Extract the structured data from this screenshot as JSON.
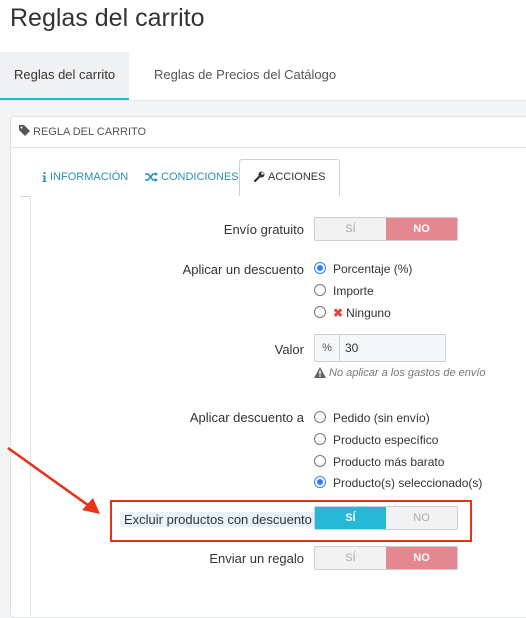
{
  "header": {
    "title": "Reglas del carrito"
  },
  "subtabs": [
    {
      "label": "Reglas del carrito"
    },
    {
      "label": "Reglas de Precios del Catálogo"
    }
  ],
  "panel": {
    "heading": "REGLA DEL CARRITO"
  },
  "tabs": [
    {
      "label": "INFORMACIÓN",
      "icon": "info-icon"
    },
    {
      "label": "CONDICIONES",
      "icon": "shuffle-icon"
    },
    {
      "label": "ACCIONES",
      "icon": "wrench-icon"
    }
  ],
  "form": {
    "free_shipping": {
      "label": "Envío gratuito",
      "yes": "SÍ",
      "no": "NO",
      "selected": "NO"
    },
    "discount": {
      "label": "Aplicar un descuento",
      "options": [
        "Porcentaje (%)",
        "Importe",
        "Ninguno"
      ],
      "selected": "Porcentaje (%)"
    },
    "value": {
      "label": "Valor",
      "addon": "%",
      "value": "30",
      "help": "No aplicar a los gastos de envío"
    },
    "apply_to": {
      "label": "Aplicar descuento a",
      "options": [
        "Pedido (sin envío)",
        "Producto específico",
        "Producto más barato",
        "Producto(s) seleccionado(s)"
      ],
      "selected": "Producto(s) seleccionado(s)"
    },
    "exclude_discounted": {
      "label": "Excluir productos con descuento",
      "yes": "SÍ",
      "no": "NO",
      "selected": "SÍ"
    },
    "gift": {
      "label": "Enviar un regalo",
      "yes": "SÍ",
      "no": "NO",
      "selected": "NO"
    }
  },
  "colors": {
    "accent": "#25b9d7",
    "no_active": "#e5878e",
    "annotation": "#e8331b",
    "radio_selected": "#2a7fff"
  }
}
